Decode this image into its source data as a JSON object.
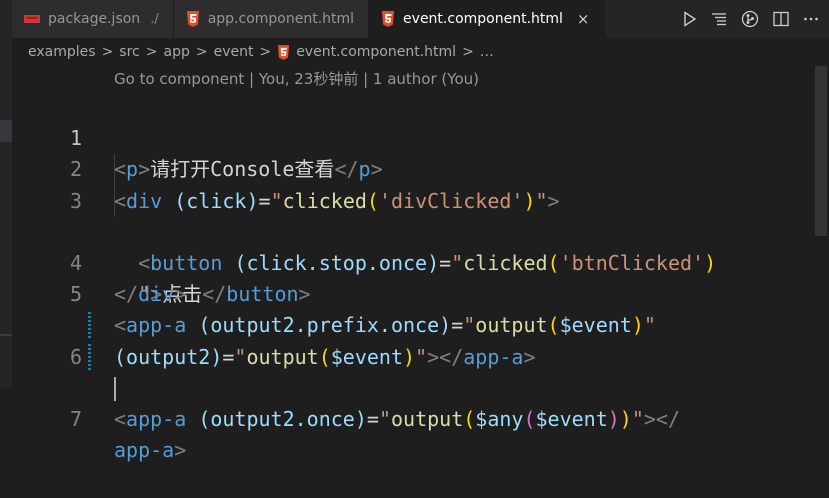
{
  "tabs": [
    {
      "label": "package.json",
      "desc": "./",
      "icon": "npm-icon",
      "active": false
    },
    {
      "label": "app.component.html",
      "desc": "",
      "icon": "html5-icon",
      "active": false
    },
    {
      "label": "event.component.html",
      "desc": "",
      "icon": "html5-icon",
      "active": true,
      "close": "×"
    }
  ],
  "toolbar": {
    "run": "run-icon",
    "outline": "outline-icon",
    "git": "git-compare-icon",
    "split": "split-editor-icon",
    "more": "more-icon"
  },
  "breadcrumb": {
    "items": [
      "examples",
      "src",
      "app",
      "event",
      "event.component.html",
      "…"
    ],
    "separator": ">"
  },
  "codelens": "Go to component | You, 23秒钟前 | 1 author (You)",
  "line_numbers": [
    "1",
    "2",
    "3",
    "",
    "4",
    "5",
    "",
    "6",
    "",
    "7"
  ],
  "tokens": {
    "l1": [
      "<",
      "p",
      ">",
      "请打开Console查看",
      "</",
      "p",
      ">"
    ],
    "l2": [
      "<",
      "div",
      " ",
      "(click)",
      "=",
      "\"",
      "clicked",
      "(",
      "'divClicked'",
      ")",
      "\"",
      ">"
    ],
    "l3": [
      "  ",
      "<",
      "button",
      " ",
      "(click.stop.once)",
      "=",
      "\"",
      "clicked",
      "(",
      "'btnClicked'",
      ")"
    ],
    "l3b": [
      "  ",
      "\"",
      ">",
      "点击",
      "</",
      "button",
      ">"
    ],
    "l4": [
      "</",
      "div",
      ">"
    ],
    "l5": [
      "<",
      "app-a",
      " ",
      "(output2.prefix.once)",
      "=",
      "\"",
      "output",
      "(",
      "$event",
      ")",
      "\""
    ],
    "l5b": [
      "(output2)",
      "=",
      "\"",
      "output",
      "(",
      "$event",
      ")",
      "\"",
      "></",
      "app-a",
      ">"
    ],
    "l6": [
      "<",
      "app-a",
      " ",
      "(output2.once)",
      "=",
      "\"",
      "output",
      "(",
      "$any",
      "(",
      "$event",
      ")",
      ")",
      "\"",
      "></"
    ],
    "l6b": [
      "app-a",
      ">"
    ]
  },
  "colors": {
    "background": "#1e1e1e",
    "tag": "#569cd6",
    "attribute": "#9cdcfe",
    "string": "#ce9178",
    "function": "#dcdcaa",
    "bracket1": "#ffd700",
    "bracket2": "#da70d6",
    "html5": "#e44d26",
    "npm": "#cb3837"
  }
}
